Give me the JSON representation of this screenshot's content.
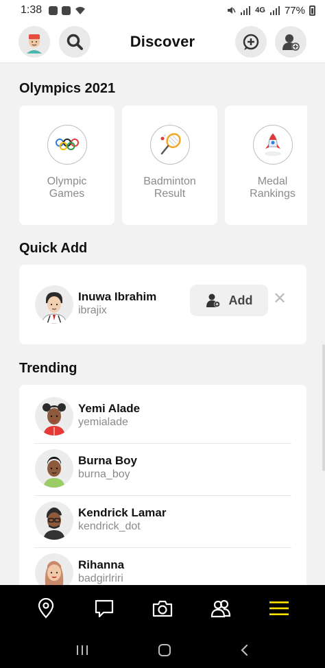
{
  "status_bar": {
    "time": "1:38",
    "network": "4G",
    "battery": "77%"
  },
  "header": {
    "title": "Discover"
  },
  "olympics": {
    "title": "Olympics 2021",
    "cards": [
      {
        "label": "Olympic\nGames",
        "icon": "olympic-rings-icon"
      },
      {
        "label": "Badminton\nResult",
        "icon": "badminton-racket-icon"
      },
      {
        "label": "Medal\nRankings",
        "icon": "rocket-icon"
      }
    ]
  },
  "quick_add": {
    "title": "Quick Add",
    "user": {
      "name": "Inuwa Ibrahim",
      "handle": "ibrajix"
    },
    "add_label": "Add",
    "dismiss_label": "✕"
  },
  "trending": {
    "title": "Trending",
    "users": [
      {
        "name": "Yemi Alade",
        "handle": "yemialade"
      },
      {
        "name": "Burna Boy",
        "handle": "burna_boy"
      },
      {
        "name": "Kendrick Lamar",
        "handle": "kendrick_dot"
      },
      {
        "name": "Rihanna",
        "handle": "badgirlriri"
      }
    ]
  },
  "colors": {
    "accent": "#FFE200",
    "background": "#F2F2F2",
    "nav_bg": "#000000"
  }
}
